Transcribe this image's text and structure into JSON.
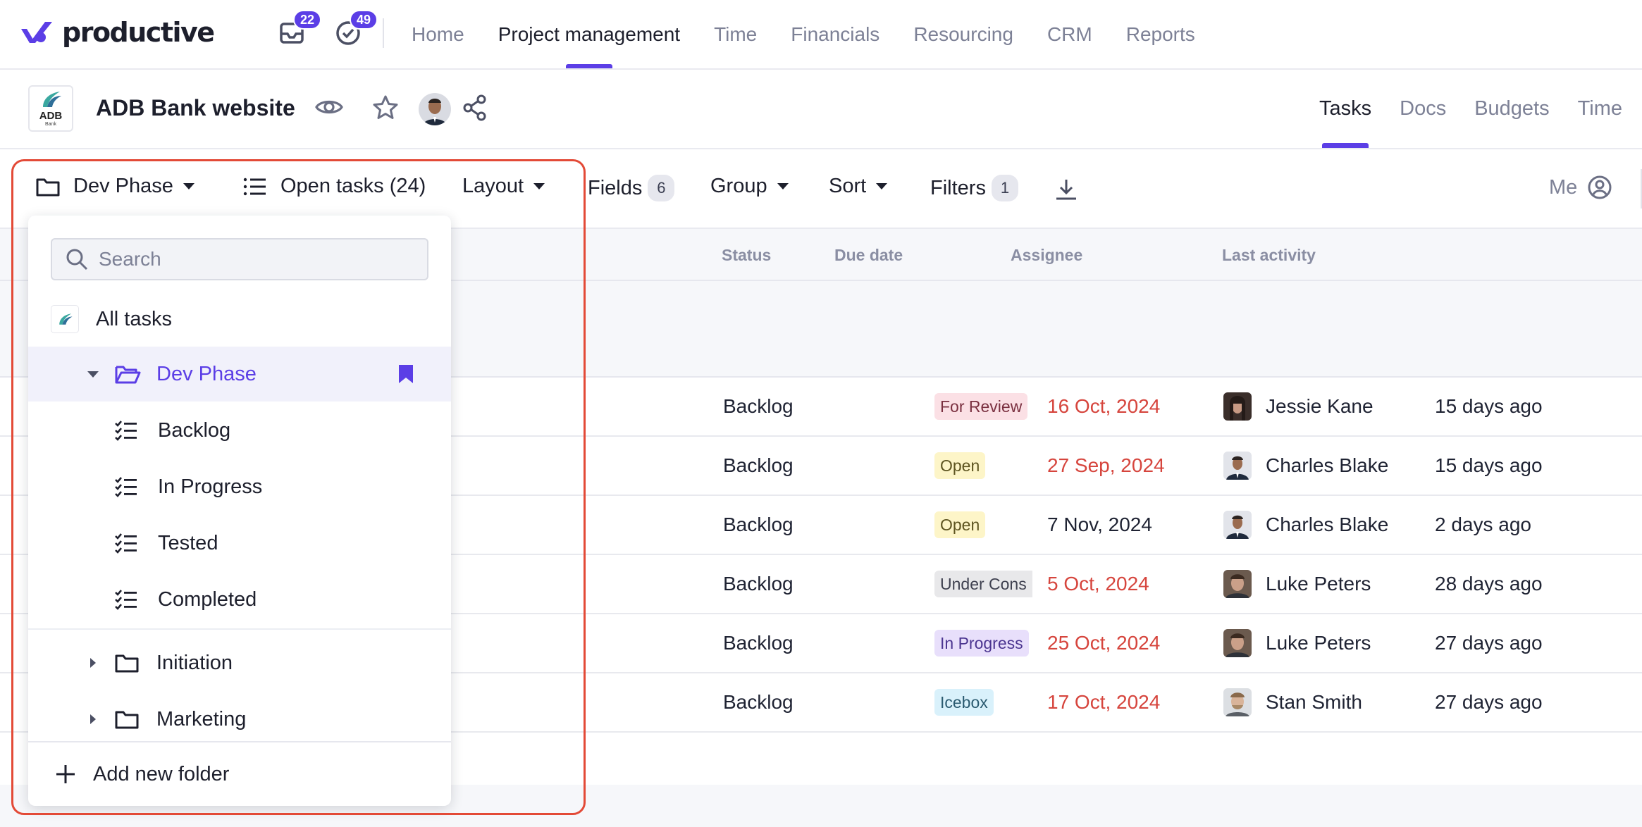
{
  "brand": {
    "name": "productive",
    "color": "#5b3ee6"
  },
  "nav": {
    "inbox_count": "22",
    "tasks_count": "49",
    "links": [
      {
        "label": "Home"
      },
      {
        "label": "Project management"
      },
      {
        "label": "Time"
      },
      {
        "label": "Financials"
      },
      {
        "label": "Resourcing"
      },
      {
        "label": "CRM"
      },
      {
        "label": "Reports"
      }
    ],
    "active_link": "Project management"
  },
  "project": {
    "logo_text": "ADB",
    "logo_subtext": "Bank",
    "title": "ADB Bank website",
    "tabs": [
      {
        "label": "Tasks"
      },
      {
        "label": "Docs"
      },
      {
        "label": "Budgets"
      },
      {
        "label": "Time"
      }
    ],
    "active_tab": "Tasks"
  },
  "toolbar": {
    "folder": "Dev Phase",
    "open_tasks": "Open tasks (24)",
    "layout": "Layout",
    "fields": "Fields",
    "fields_count": "6",
    "group": "Group",
    "sort": "Sort",
    "filters": "Filters",
    "filters_count": "1",
    "me": "Me"
  },
  "table": {
    "headers": {
      "status": "Status",
      "due_date": "Due date",
      "assignee": "Assignee",
      "last_activity": "Last activity"
    },
    "rows": [
      {
        "list": "Backlog",
        "tag": "For Review",
        "tag_bg": "#fbe0e5",
        "tag_fg": "#7a3040",
        "due": "16 Oct, 2024",
        "overdue": true,
        "assignee": "Jessie Kane",
        "last_activity": "15 days ago"
      },
      {
        "list": "Backlog",
        "tag": "Open",
        "tag_bg": "#fdf5c8",
        "tag_fg": "#5d5420",
        "due": "27 Sep, 2024",
        "overdue": true,
        "assignee": "Charles Blake",
        "last_activity": "15 days ago"
      },
      {
        "list": "Backlog",
        "tag": "Open",
        "tag_bg": "#fdf5c8",
        "tag_fg": "#5d5420",
        "due": "7 Nov, 2024",
        "overdue": false,
        "assignee": "Charles Blake",
        "last_activity": "2 days ago"
      },
      {
        "list": "Backlog",
        "tag": "Under Cons",
        "tag_bg": "#e8e8ea",
        "tag_fg": "#3f4150",
        "due": "5 Oct, 2024",
        "overdue": true,
        "assignee": "Luke Peters",
        "last_activity": "28 days ago"
      },
      {
        "list": "Backlog",
        "tag": "In Progress",
        "tag_bg": "#e8dffb",
        "tag_fg": "#4b3590",
        "due": "25 Oct, 2024",
        "overdue": true,
        "assignee": "Luke Peters",
        "last_activity": "27 days ago"
      },
      {
        "list": "Backlog",
        "tag": "Icebox",
        "tag_bg": "#d9f1fb",
        "tag_fg": "#2a5a70",
        "due": "17 Oct, 2024",
        "overdue": true,
        "assignee": "Stan Smith",
        "last_activity": "27 days ago"
      }
    ]
  },
  "dropdown": {
    "search_placeholder": "Search",
    "all_tasks": "All tasks",
    "selected_folder": "Dev Phase",
    "lists": [
      "Backlog",
      "In Progress",
      "Tested",
      "Completed"
    ],
    "other_folders": [
      "Initiation",
      "Marketing"
    ],
    "add_folder": "Add new folder"
  },
  "colors": {
    "accent": "#5b3ee6",
    "overdue": "#d6453d",
    "highlight": "#e34a37"
  }
}
